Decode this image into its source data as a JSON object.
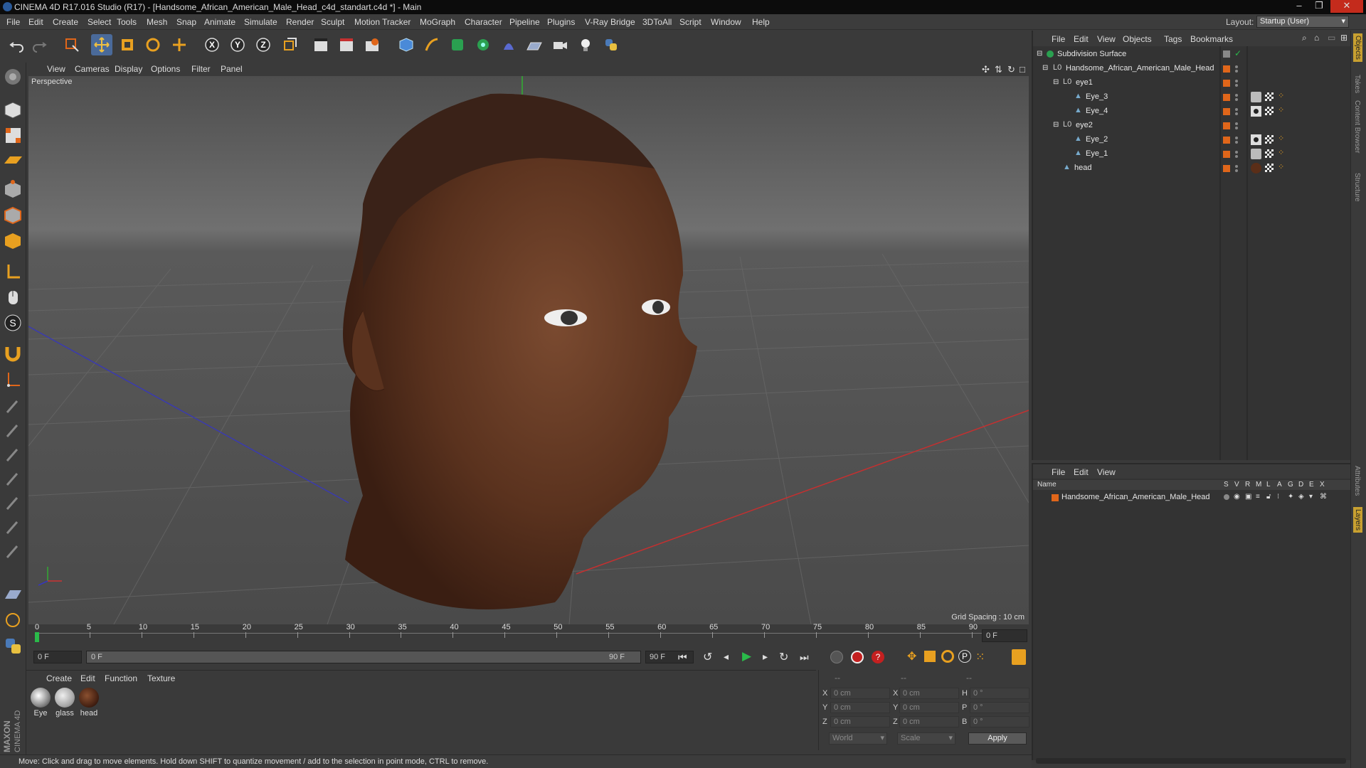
{
  "window": {
    "title": "CINEMA 4D R17.016 Studio (R17) - [Handsome_African_American_Male_Head_c4d_standart.c4d *] - Main"
  },
  "menu": [
    "File",
    "Edit",
    "Create",
    "Select",
    "Tools",
    "Mesh",
    "Snap",
    "Animate",
    "Simulate",
    "Render",
    "Sculpt",
    "Motion Tracker",
    "MoGraph",
    "Character",
    "Pipeline",
    "Plugins",
    "V-Ray Bridge",
    "3DToAll",
    "Script",
    "Window",
    "Help"
  ],
  "layout": {
    "label": "Layout:",
    "value": "Startup (User)"
  },
  "viewport": {
    "menu": [
      "View",
      "Cameras",
      "Display",
      "Options",
      "Filter",
      "Panel"
    ],
    "camera_label": "Perspective",
    "grid_spacing": "Grid Spacing : 10 cm"
  },
  "timeline": {
    "ticks": [
      "0",
      "5",
      "10",
      "15",
      "20",
      "25",
      "30",
      "35",
      "40",
      "45",
      "50",
      "55",
      "60",
      "65",
      "70",
      "75",
      "80",
      "85",
      "90"
    ],
    "current_frame_display": "0 F",
    "start_field": "0 F",
    "range_start": "0 F",
    "range_end": "90 F",
    "end_field": "90 F"
  },
  "materials": {
    "menu": [
      "Create",
      "Edit",
      "Function",
      "Texture"
    ],
    "items": [
      {
        "name": "Eye"
      },
      {
        "name": "glass"
      },
      {
        "name": "head"
      }
    ]
  },
  "coordinates": {
    "header": [
      "--",
      "--",
      "--"
    ],
    "rows": [
      {
        "l1": "X",
        "v1": "0 cm",
        "l2": "X",
        "v2": "0 cm",
        "l3": "H",
        "v3": "0 °"
      },
      {
        "l1": "Y",
        "v1": "0 cm",
        "l2": "Y",
        "v2": "0 cm",
        "l3": "P",
        "v3": "0 °"
      },
      {
        "l1": "Z",
        "v1": "0 cm",
        "l2": "Z",
        "v2": "0 cm",
        "l3": "B",
        "v3": "0 °"
      }
    ],
    "mode": "World",
    "scale": "Scale",
    "apply": "Apply"
  },
  "objects": {
    "menu": [
      "File",
      "Edit",
      "View",
      "Objects",
      "Tags",
      "Bookmarks"
    ],
    "tree": [
      {
        "name": "Subdivision Surface",
        "checked": true
      },
      {
        "name": "Handsome_African_American_Male_Head"
      },
      {
        "name": "eye1"
      },
      {
        "name": "Eye_3"
      },
      {
        "name": "Eye_4"
      },
      {
        "name": "eye2"
      },
      {
        "name": "Eye_2"
      },
      {
        "name": "Eye_1"
      },
      {
        "name": "head"
      }
    ]
  },
  "layers": {
    "menu": [
      "File",
      "Edit",
      "View"
    ],
    "columns": [
      "Name",
      "S",
      "V",
      "R",
      "M",
      "L",
      "A",
      "G",
      "D",
      "E",
      "X"
    ],
    "rows": [
      {
        "name": "Handsome_African_American_Male_Head"
      }
    ]
  },
  "side_tabs": [
    "Objects",
    "Takes",
    "Content Browser",
    "Structure",
    "Attributes",
    "Layers"
  ],
  "status": "Move: Click and drag to move elements. Hold down SHIFT to quantize movement / add to the selection in point mode, CTRL to remove.",
  "brand": {
    "maxon": "MAXON",
    "product": "CINEMA 4D"
  },
  "colors": {
    "accent_orange": "#e0661a",
    "axis_red": "#c43030",
    "axis_blue": "#3030b0",
    "active_blue": "#3a7ad0"
  }
}
